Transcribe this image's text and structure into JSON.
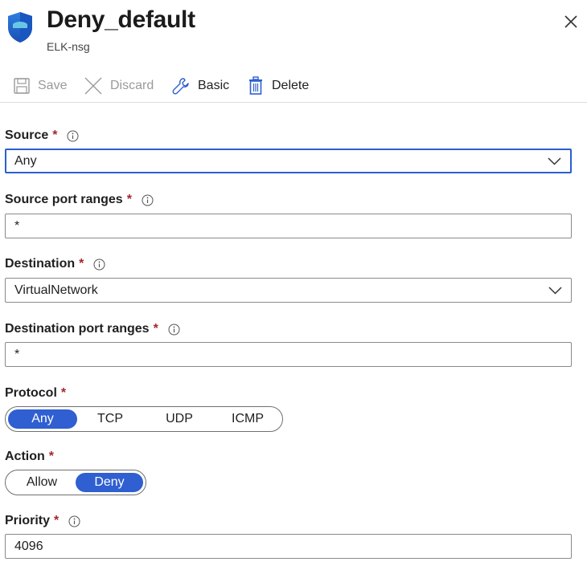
{
  "header": {
    "title": "Deny_default",
    "subtitle": "ELK-nsg"
  },
  "toolbar": {
    "save_label": "Save",
    "discard_label": "Discard",
    "basic_label": "Basic",
    "delete_label": "Delete"
  },
  "fields": {
    "source": {
      "label": "Source",
      "required": "*",
      "value": "Any"
    },
    "source_port_ranges": {
      "label": "Source port ranges",
      "required": "*",
      "value": "*"
    },
    "destination": {
      "label": "Destination",
      "required": "*",
      "value": "VirtualNetwork"
    },
    "destination_port_ranges": {
      "label": "Destination port ranges",
      "required": "*",
      "value": "*"
    },
    "protocol": {
      "label": "Protocol",
      "required": "*",
      "options": [
        "Any",
        "TCP",
        "UDP",
        "ICMP"
      ],
      "selected": "Any"
    },
    "action": {
      "label": "Action",
      "required": "*",
      "options": [
        "Allow",
        "Deny"
      ],
      "selected": "Deny"
    },
    "priority": {
      "label": "Priority",
      "required": "*",
      "value": "4096"
    }
  },
  "colors": {
    "accent": "#2f5fd0",
    "required": "#a4262c",
    "disabled_text": "#9a9a9a"
  },
  "icons": {
    "shield": "shield-icon",
    "close": "close-icon",
    "save": "save-icon",
    "discard": "discard-icon",
    "basic": "wrench-icon",
    "delete": "trash-icon",
    "info": "info-icon",
    "chevron": "chevron-down-icon"
  }
}
